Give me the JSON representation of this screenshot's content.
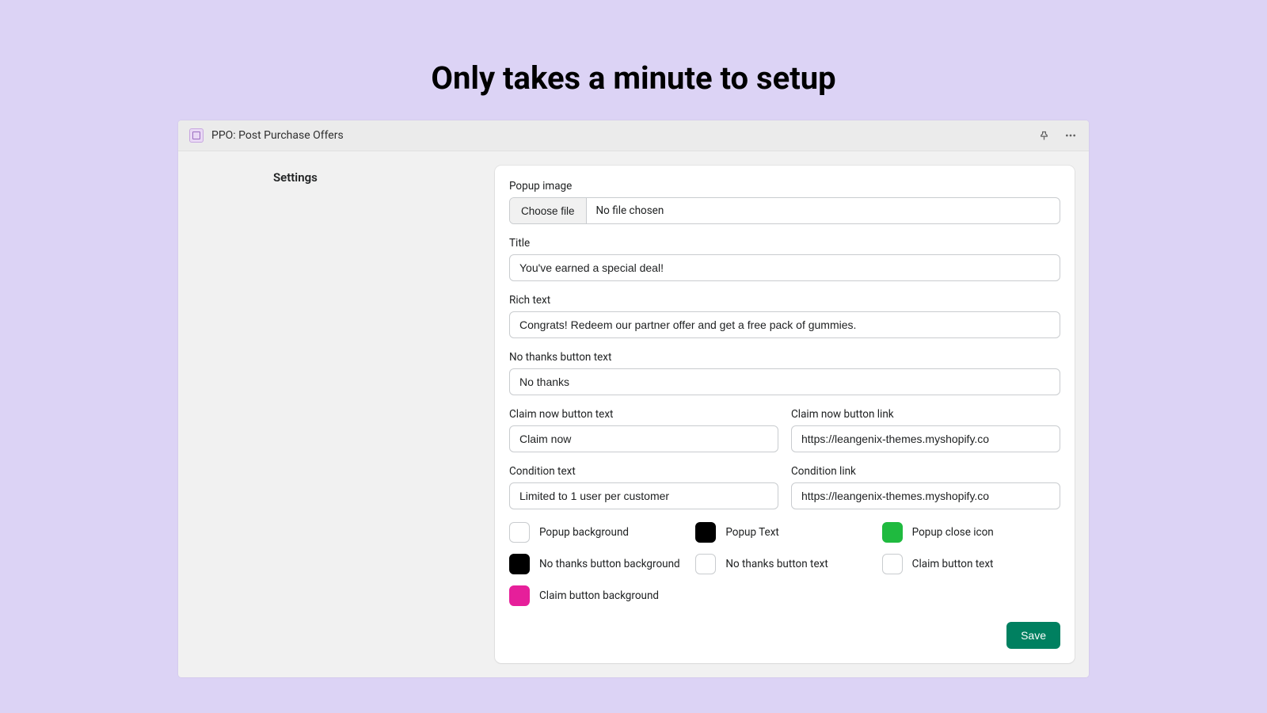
{
  "headline": "Only takes a minute to setup",
  "titlebar": {
    "app_name": "PPO: Post Purchase Offers"
  },
  "sidebar": {
    "title": "Settings"
  },
  "form": {
    "popup_image_label": "Popup image",
    "choose_file": "Choose file",
    "no_file": "No file chosen",
    "title_label": "Title",
    "title_value": "You've earned a special deal!",
    "rich_text_label": "Rich text",
    "rich_text_value": "Congrats! Redeem our partner offer and get a free pack of gummies.",
    "no_thanks_label": "No thanks button text",
    "no_thanks_value": "No thanks",
    "claim_text_label": "Claim now button text",
    "claim_text_value": "Claim now",
    "claim_link_label": "Claim now button link",
    "claim_link_value": "https://leangenix-themes.myshopify.co",
    "condition_text_label": "Condition text",
    "condition_text_value": "Limited to 1 user per customer",
    "condition_link_label": "Condition link",
    "condition_link_value": "https://leangenix-themes.myshopify.co",
    "save": "Save"
  },
  "colors": [
    {
      "label": "Popup background",
      "value": "#ffffff"
    },
    {
      "label": "Popup Text",
      "value": "#000000"
    },
    {
      "label": "Popup close icon",
      "value": "#1fba3f"
    },
    {
      "label": "No thanks button background",
      "value": "#000000"
    },
    {
      "label": "No thanks button text",
      "value": "#ffffff"
    },
    {
      "label": "Claim button text",
      "value": "#ffffff"
    },
    {
      "label": "Claim button background",
      "value": "#e61f9a"
    }
  ]
}
